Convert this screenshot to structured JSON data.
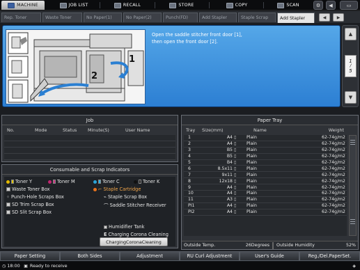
{
  "top_tabs": [
    {
      "label": "MACHINE",
      "icon": "machine-icon",
      "active": true
    },
    {
      "label": "JOB LIST",
      "icon": "job-list-icon",
      "active": false
    },
    {
      "label": "RECALL",
      "icon": "recall-icon",
      "active": false
    },
    {
      "label": "STORE",
      "icon": "store-icon",
      "active": false
    },
    {
      "label": "COPY",
      "icon": "copy-icon",
      "active": false
    },
    {
      "label": "SCAN",
      "icon": "scan-icon",
      "active": false
    }
  ],
  "sub_tabs": [
    "Rep. Toner",
    "Waste Toner",
    "No Paper(1)",
    "No Paper(2)",
    "Punch(FD)",
    "Add Stapler",
    "Staple Scrap",
    "Add Stapler"
  ],
  "guide": {
    "text_line1": "Open the saddle stitcher front door [1],",
    "text_line2": "then open the front door [2].",
    "step1": "1",
    "step2": "2",
    "page_top": "1",
    "page_bottom": "5"
  },
  "job": {
    "title": "Job",
    "columns": [
      "No.",
      "Mode",
      "Status",
      "Minute(S)",
      "User Name"
    ]
  },
  "consumables": {
    "title": "Consumable and Scrap Indicators",
    "items": {
      "toner_y": "Toner Y",
      "toner_m": "Toner M",
      "toner_c": "Toner C",
      "toner_k": "Toner K",
      "waste_toner": "Waste Toner Box",
      "staple_cartridge": "Staple Cartridge",
      "punch_hole": "Punch-Hole Scraps Box",
      "staple_scrap": "Staple Scrap Box",
      "sd_trim": "SD Trim Scrap Box",
      "saddle_stitcher": "Saddle Stitcher Receiver",
      "sd_slit": "SD Slit Scrap Box",
      "humidifier": "Humidifier Tank",
      "charging_corona": "Charging Corona Cleaning"
    },
    "button": "ChargingCoronaCleaning"
  },
  "paper_tray": {
    "title": "Paper Tray",
    "columns": [
      "Tray",
      "Size(mm)",
      "Name",
      "Weight"
    ],
    "rows": [
      {
        "tray": "1",
        "size": "A4",
        "name": "Plain",
        "weight": "62-74g/m2"
      },
      {
        "tray": "2",
        "size": "A4",
        "name": "Plain",
        "weight": "62-74g/m2"
      },
      {
        "tray": "3",
        "size": "B5",
        "name": "Plain",
        "weight": "62-74g/m2"
      },
      {
        "tray": "4",
        "size": "B5",
        "name": "Plain",
        "weight": "62-74g/m2"
      },
      {
        "tray": "5",
        "size": "B4",
        "name": "Plain",
        "weight": "62-74g/m2"
      },
      {
        "tray": "6",
        "size": "8.5x11",
        "name": "Plain",
        "weight": "62-74g/m2"
      },
      {
        "tray": "7",
        "size": "9x11",
        "name": "Plain",
        "weight": "62-74g/m2"
      },
      {
        "tray": "8",
        "size": "12x18",
        "name": "Plain",
        "weight": "62-74g/m2"
      },
      {
        "tray": "9",
        "size": "A4",
        "name": "Plain",
        "weight": "62-74g/m2"
      },
      {
        "tray": "10",
        "size": "A4",
        "name": "Plain",
        "weight": "62-74g/m2"
      },
      {
        "tray": "11",
        "size": "A3",
        "name": "Plain",
        "weight": "62-74g/m2"
      },
      {
        "tray": "PI1",
        "size": "A4",
        "name": "Plain",
        "weight": "62-74g/m2"
      },
      {
        "tray": "PI2",
        "size": "A4",
        "name": "Plain",
        "weight": "62-74g/m2"
      }
    ],
    "outside_temp_label": "Outside Temp.",
    "outside_temp_value": "26Degrees",
    "outside_humidity_label": "Outside Humidity",
    "outside_humidity_value": "52%"
  },
  "bottom_buttons": [
    "Paper Setting",
    "Both Sides",
    "Adjustment",
    "RU Curl Adjustment",
    "User's Guide",
    "Reg./Del.PaperSet."
  ],
  "status": {
    "time": "18:00",
    "message": "Ready to receive"
  },
  "colors": {
    "guide_blue": "#3b8fe0",
    "orange": "#e8731c"
  }
}
